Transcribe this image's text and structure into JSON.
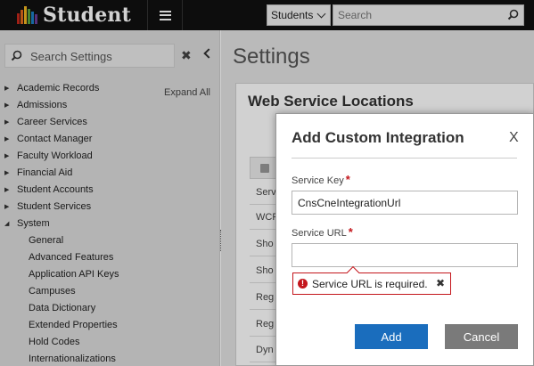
{
  "app": {
    "name": "Student",
    "logo_colors": [
      "#c2281b",
      "#e06a1b",
      "#f1b521",
      "#5aa43a",
      "#1b7fc4",
      "#6a3c96"
    ]
  },
  "topbar": {
    "scope_label": "Students",
    "search_placeholder": "Search",
    "search_icon": "search-icon",
    "menu_icon": "hamburger-icon"
  },
  "sidebar": {
    "search_placeholder": "Search Settings",
    "expand_all": "Expand All",
    "clear_icon": "close-icon",
    "collapse_icon": "chevron-left-icon",
    "items": [
      {
        "label": "Academic Records",
        "state": "collapsed"
      },
      {
        "label": "Admissions",
        "state": "collapsed"
      },
      {
        "label": "Career Services",
        "state": "collapsed"
      },
      {
        "label": "Contact Manager",
        "state": "collapsed"
      },
      {
        "label": "Faculty Workload",
        "state": "collapsed"
      },
      {
        "label": "Financial Aid",
        "state": "collapsed"
      },
      {
        "label": "Student Accounts",
        "state": "collapsed"
      },
      {
        "label": "Student Services",
        "state": "collapsed"
      },
      {
        "label": "System",
        "state": "expanded"
      }
    ],
    "system_children": [
      "General",
      "Advanced Features",
      "Application API Keys",
      "Campuses",
      "Data Dictionary",
      "Extended Properties",
      "Hold Codes",
      "Internationalizations"
    ]
  },
  "main": {
    "page_title": "Settings",
    "panel_title": "Web Service Locations",
    "grid_rows": [
      "Serv",
      "WCF",
      "Sho",
      "Sho",
      "Reg",
      "Reg",
      "Dyn"
    ]
  },
  "modal": {
    "title": "Add Custom Integration",
    "close": "X",
    "service_key_label": "Service Key",
    "service_key_value": "CnsCneIntegrationUrl",
    "service_url_label": "Service URL",
    "service_url_value": "",
    "required_marker": "*",
    "error_icon": "!",
    "error_text": "Service URL is required.",
    "error_dismiss": "✖",
    "add_label": "Add",
    "cancel_label": "Cancel"
  }
}
